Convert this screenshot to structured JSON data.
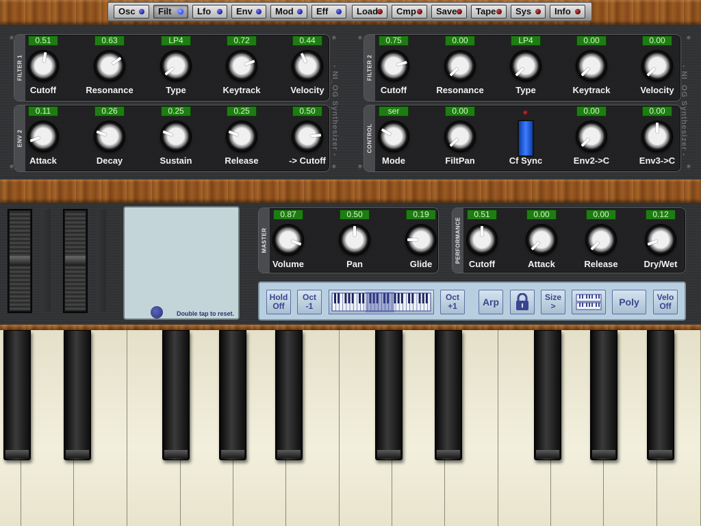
{
  "nav": [
    {
      "label": "Osc",
      "led": "blue"
    },
    {
      "label": "Filt",
      "led": "bluebright",
      "active": true
    },
    {
      "label": "Lfo",
      "led": "blue"
    },
    {
      "label": "Env",
      "led": "blue"
    },
    {
      "label": "Mod",
      "led": "blue"
    },
    {
      "label": "Eff",
      "led": "blue"
    },
    {
      "label": "Load",
      "led": "red"
    },
    {
      "label": "Cmp",
      "led": "red"
    },
    {
      "label": "Save",
      "led": "red"
    },
    {
      "label": "Tape",
      "led": "red"
    },
    {
      "label": "Sys",
      "led": "red"
    },
    {
      "label": "Info",
      "led": "red"
    }
  ],
  "watermark": "- NI_OG Synthesizer -",
  "filter1": {
    "tag": "FILTER 1",
    "controls": [
      {
        "value": "0.51",
        "label": "Cutoff",
        "angle": 10
      },
      {
        "value": "0.63",
        "label": "Resonance",
        "angle": 55
      },
      {
        "value": "LP4",
        "label": "Type",
        "angle": -130
      },
      {
        "value": "0.72",
        "label": "Keytrack",
        "angle": 70
      },
      {
        "value": "0.44",
        "label": "Velocity",
        "angle": -25
      }
    ]
  },
  "filter2": {
    "tag": "FILTER 2",
    "controls": [
      {
        "value": "0.75",
        "label": "Cutoff",
        "angle": 75
      },
      {
        "value": "0.00",
        "label": "Resonance",
        "angle": -135
      },
      {
        "value": "LP4",
        "label": "Type",
        "angle": -135
      },
      {
        "value": "0.00",
        "label": "Keytrack",
        "angle": -135
      },
      {
        "value": "0.00",
        "label": "Velocity",
        "angle": -135
      }
    ]
  },
  "env2": {
    "tag": "ENV 2",
    "controls": [
      {
        "value": "0.11",
        "label": "Attack",
        "angle": -110
      },
      {
        "value": "0.26",
        "label": "Decay",
        "angle": -70
      },
      {
        "value": "0.25",
        "label": "Sustain",
        "angle": -70
      },
      {
        "value": "0.25",
        "label": "Release",
        "angle": -70
      },
      {
        "value": "0.50",
        "label": "-> Cutoff",
        "angle": 85
      }
    ]
  },
  "control": {
    "tag": "CONTROL",
    "controls": [
      {
        "value": "ser",
        "label": "Mode",
        "angle": -60
      },
      {
        "value": "0.00",
        "label": "FiltPan",
        "angle": -135
      },
      {
        "label": "Cf Sync",
        "type": "toggle"
      },
      {
        "value": "0.00",
        "label": "Env2->C",
        "angle": -135
      },
      {
        "value": "0.00",
        "label": "Env3->C",
        "angle": 0
      }
    ]
  },
  "master": {
    "tag": "MASTER",
    "controls": [
      {
        "value": "0.87",
        "label": "Volume",
        "angle": 110
      },
      {
        "value": "0.50",
        "label": "Pan",
        "angle": 0
      },
      {
        "value": "0.19",
        "label": "Glide",
        "angle": -90
      }
    ]
  },
  "performance": {
    "tag": "PERFORMANCE",
    "controls": [
      {
        "value": "0.51",
        "label": "Cutoff",
        "angle": 0
      },
      {
        "value": "0.00",
        "label": "Attack",
        "angle": -135
      },
      {
        "value": "0.00",
        "label": "Release",
        "angle": -135
      },
      {
        "value": "0.12",
        "label": "Dry/Wet",
        "angle": -110
      }
    ]
  },
  "xypad": {
    "hint": "Double tap to reset."
  },
  "perfbar": {
    "hold": {
      "line1": "Hold",
      "line2": "Off"
    },
    "oct_down": {
      "line1": "Oct",
      "line2": "-1"
    },
    "oct_up": {
      "line1": "Oct",
      "line2": "+1"
    },
    "arp": "Arp",
    "size": {
      "line1": "Size",
      "line2": ">"
    },
    "poly": "Poly",
    "velo": {
      "line1": "Velo",
      "line2": "Off"
    }
  },
  "colors": {
    "value_box": "#1e7d12",
    "active_led": "#2e45ff",
    "toggle": "#3c7cff",
    "perf_bar": "#b8cfe0"
  }
}
